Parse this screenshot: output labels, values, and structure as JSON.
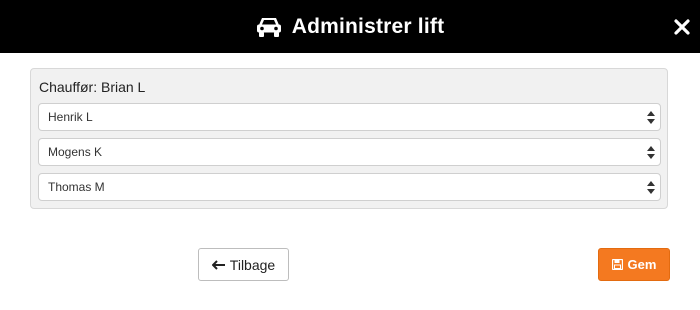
{
  "header": {
    "title": "Administrer lift",
    "icon": "car-icon",
    "close_icon": "close-icon",
    "background": "#000000"
  },
  "panel": {
    "driver_label": "Chauffør: Brian L",
    "passengers": [
      {
        "selected": "Henrik L"
      },
      {
        "selected": "Mogens K"
      },
      {
        "selected": "Thomas M"
      }
    ]
  },
  "actions": {
    "back_label": "Tilbage",
    "back_icon": "arrow-left-icon",
    "save_label": "Gem",
    "save_icon": "floppy-disk-icon",
    "save_color": "#f47920"
  }
}
